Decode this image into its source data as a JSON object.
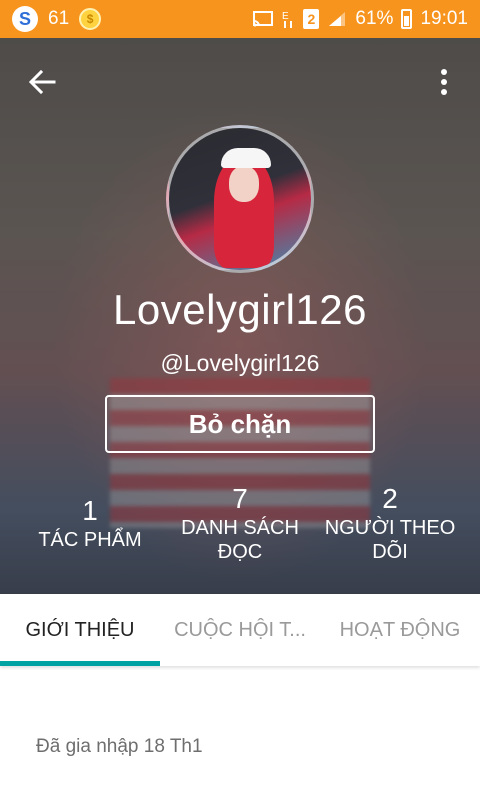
{
  "status_bar": {
    "app_icon_letter": "S",
    "notification_count": "61",
    "sim_slot": "2",
    "battery_percent": "61%",
    "time": "19:01",
    "icons": [
      "s-app-icon",
      "coin-icon",
      "cast-icon",
      "data-e-icon",
      "sim-icon",
      "signal-icon",
      "battery-icon"
    ]
  },
  "profile": {
    "display_name": "Lovelygirl126",
    "handle": "@Lovelygirl126",
    "unblock_label": "Bỏ chặn"
  },
  "stats": {
    "works": {
      "value": "1",
      "label": "TÁC PHẨM"
    },
    "reading_lists": {
      "value": "7",
      "label": "DANH SÁCH ĐỌC"
    },
    "followers": {
      "value": "2",
      "label": "NGƯỜI THEO DÕI"
    }
  },
  "tabs": [
    {
      "label": "GIỚI THIỆU",
      "active": true
    },
    {
      "label": "CUỘC HỘI T...",
      "active": false
    },
    {
      "label": "HOẠT ĐỘNG",
      "active": false
    }
  ],
  "about": {
    "joined_text": "Đã gia nhập 18 Th1"
  },
  "colors": {
    "status_bar": "#f7941d",
    "tab_indicator": "#00a2a2"
  }
}
